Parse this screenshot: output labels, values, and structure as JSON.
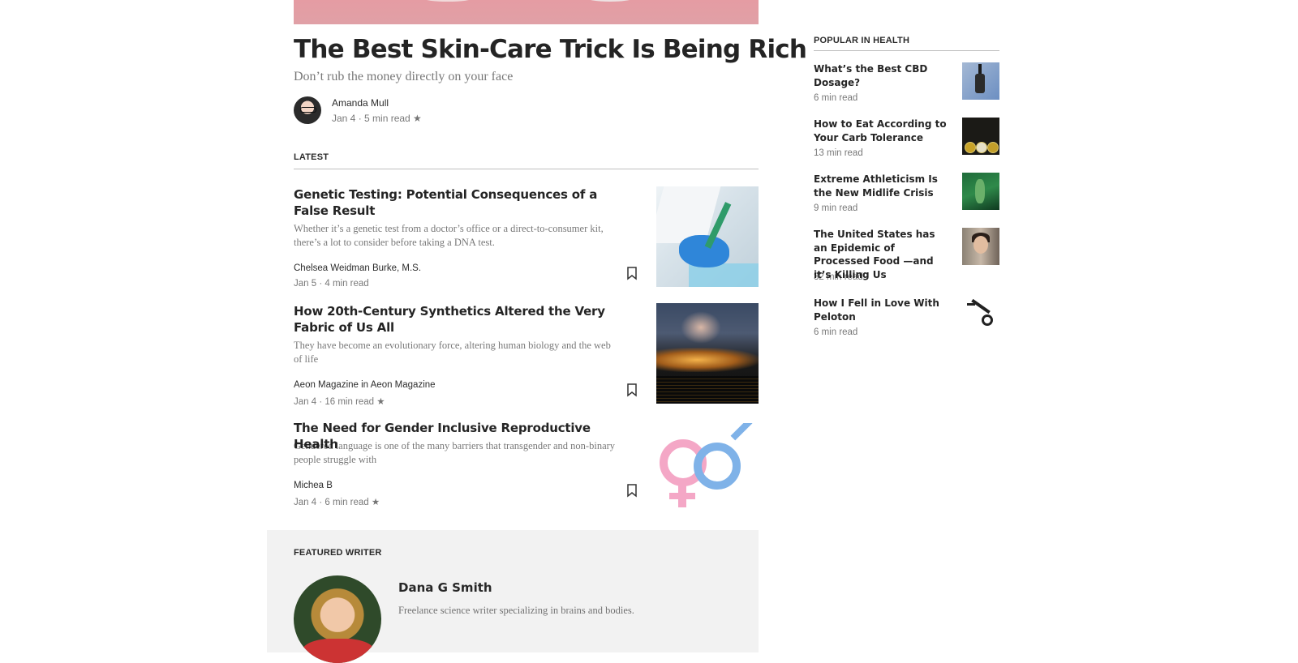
{
  "hero": {
    "title": "The Best Skin-Care Trick Is Being Rich",
    "subtitle": "Don’t rub the money directly on your face",
    "author": "Amanda Mull",
    "meta": "Jan 4 · 5 min read ★"
  },
  "latest": {
    "label": "LATEST",
    "posts": [
      {
        "title": "Genetic Testing: Potential Consequences of a False Result",
        "excerpt": "Whether it’s a genetic test from a doctor’s office or a direct-to-consumer kit, there’s a lot to consider before taking a DNA test.",
        "byline": "Chelsea Weidman Burke, M.S.",
        "meta": "Jan 5 · 4 min read",
        "thumb_icon": "lab-photo"
      },
      {
        "title": "How 20th-Century Synthetics Altered the Very Fabric of Us All",
        "excerpt": "They have become an evolutionary force, altering human biology and the web of life",
        "byline": "Aeon Magazine in Aeon Magazine",
        "meta": "Jan 4 · 16 min read ★",
        "thumb_icon": "industrial-night-photo"
      },
      {
        "title": "The Need for Gender Inclusive Reproductive Health",
        "excerpt": "Gendered language is one of the many barriers that transgender and non-binary people struggle with",
        "byline": "Michea B",
        "meta": "Jan 4 · 6 min read ★",
        "thumb_icon": "gender-symbols-image"
      }
    ]
  },
  "featured": {
    "label": "FEATURED WRITER",
    "name": "Dana G Smith",
    "bio": "Freelance science writer specializing in brains and bodies."
  },
  "sidebar": {
    "label": "POPULAR IN HEALTH",
    "items": [
      {
        "title": "What’s the Best CBD Dosage?",
        "meta": "6 min read"
      },
      {
        "title": "How to Eat According to Your Carb Tolerance",
        "meta": "13 min read"
      },
      {
        "title": "Extreme Athleticism Is the New Midlife Crisis",
        "meta": "9 min read"
      },
      {
        "title": "The United States has an Epidemic of Processed Food —and it’s Killing Us",
        "meta": "32 min read"
      },
      {
        "title": "How I Fell in Love With Peloton",
        "meta": "6 min read"
      }
    ]
  },
  "colors": {
    "text": "#000000d6",
    "muted": "#0000008a",
    "featured_bg": "#f2f2f2",
    "hero_pink": "#e59ca3"
  }
}
